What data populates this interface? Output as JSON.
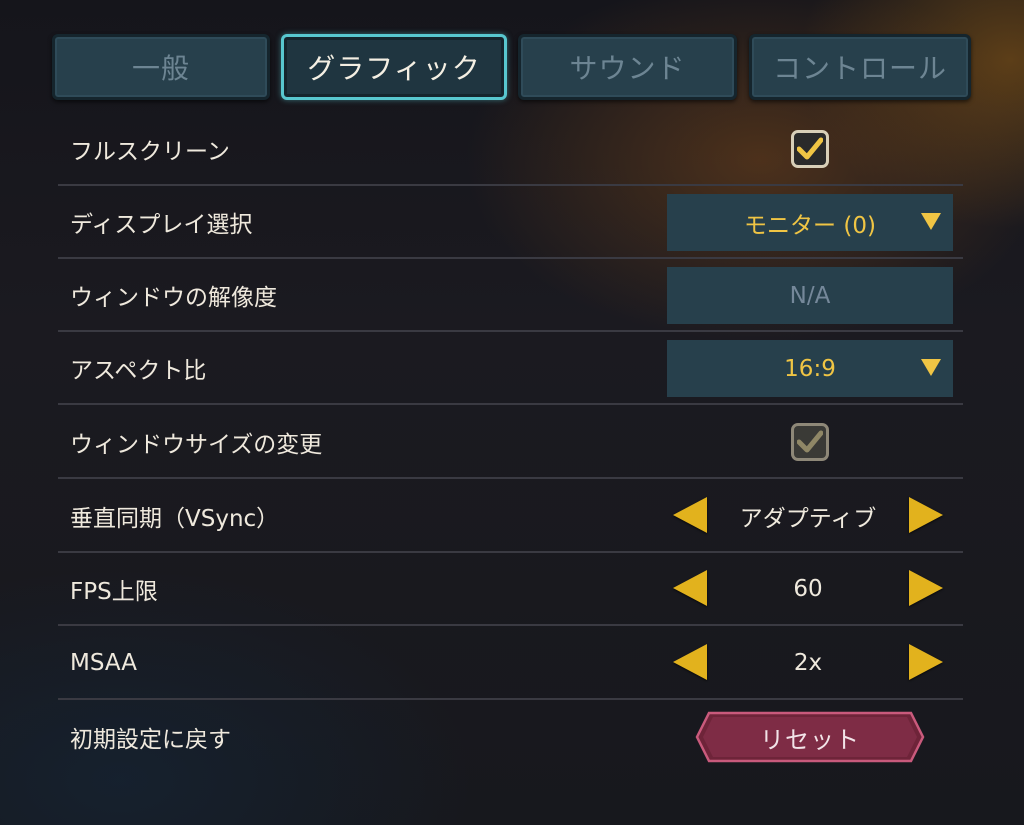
{
  "tabs": [
    {
      "label": "一般",
      "active": false
    },
    {
      "label": "グラフィック",
      "active": true
    },
    {
      "label": "サウンド",
      "active": false
    },
    {
      "label": "コントロール",
      "active": false
    }
  ],
  "settings": {
    "fullscreen": {
      "label": "フルスクリーン",
      "checked": true
    },
    "display_select": {
      "label": "ディスプレイ選択",
      "value": "モニター (0)"
    },
    "window_resolution": {
      "label": "ウィンドウの解像度",
      "value": "N/A"
    },
    "aspect_ratio": {
      "label": "アスペクト比",
      "value": "16:9"
    },
    "window_resize": {
      "label": "ウィンドウサイズの変更",
      "checked": true,
      "enabled": false
    },
    "vsync": {
      "label": "垂直同期（VSync）",
      "value": "アダプティブ"
    },
    "fps_limit": {
      "label": "FPS上限",
      "value": "60"
    },
    "msaa": {
      "label": "MSAA",
      "value": "2x"
    },
    "reset": {
      "label": "初期設定に戻す",
      "button_label": "リセット"
    }
  },
  "colors": {
    "accent_gold": "#f0c544",
    "tab_active_border": "#58c7cf",
    "panel_blue": "#27404c",
    "reset_button": "#7b2a43"
  },
  "icons": {
    "checkmark": "check-icon",
    "dropdown": "caret-down-icon",
    "prev": "arrow-left-icon",
    "next": "arrow-right-icon"
  }
}
